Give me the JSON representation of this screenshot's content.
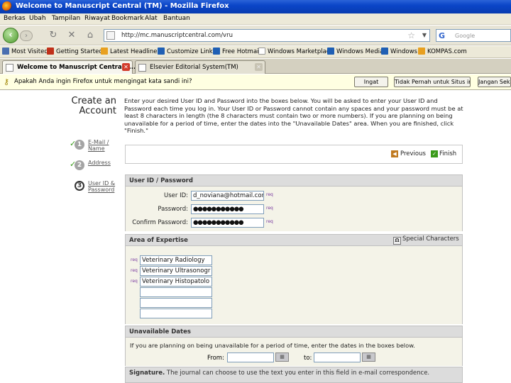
{
  "window": {
    "title": "Welcome to Manuscript Central (TM) - Mozilla Firefox"
  },
  "menu": [
    "Berkas",
    "Ubah",
    "Tampilan",
    "Riwayat",
    "Bookmark",
    "Alat",
    "Bantuan"
  ],
  "nav": {
    "url": "http://mc.manuscriptcentral.com/vru",
    "search_placeholder": "Google"
  },
  "bookmarks": [
    "Most Visited",
    "Getting Started",
    "Latest Headlines",
    "Customize Links",
    "Free Hotmail",
    "Windows Marketplace",
    "Windows Media",
    "Windows",
    "KOMPAS.com"
  ],
  "tabs": [
    {
      "label": "Welcome to Manuscript Central (..."
    },
    {
      "label": "Elsevier Editorial System(TM)"
    }
  ],
  "notification": {
    "message": "Apakah Anda ingin Firefox untuk mengingat kata sandi ini?",
    "buttons": [
      "Ingat",
      "Tidak Pernah untuk Situs ini",
      "Jangan Sekarang"
    ]
  },
  "page": {
    "title_line1": "Create an",
    "title_line2": "Account",
    "intro": "Enter your desired User ID and Password into the boxes below. You will be asked to enter your User ID and Password each time you log in. Your User ID or Password cannot contain any spaces and your password must be at least 8 characters in length (the 8 characters must contain two or more numbers). If you are planning on being unavailable for a period of time, enter the dates into the \"Unavailable Dates\" area. When you are finished, click \"Finish.\"",
    "steps": [
      {
        "num": "1",
        "label": "E-Mail / Name"
      },
      {
        "num": "2",
        "label": "Address"
      },
      {
        "num": "3",
        "label": "User ID & Password"
      }
    ],
    "previous": "Previous",
    "finish": "Finish"
  },
  "userid_section": {
    "header": "User ID / Password",
    "userid_label": "User ID:",
    "userid_value": "d_noviana@hotmail.com",
    "password_label": "Password:",
    "password_value": "●●●●●●●●●●●",
    "confirm_label": "Confirm Password:",
    "confirm_value": "●●●●●●●●●●●",
    "req": "req"
  },
  "expertise": {
    "header": "Area of Expertise",
    "special_chars": "Special Characters",
    "items": [
      "Veterinary Radiology",
      "Veterinary Ultrasonogr",
      "Veterinary Histopatolo",
      "",
      "",
      ""
    ]
  },
  "unavailable": {
    "header": "Unavailable Dates",
    "text": "If you are planning on being unavailable for a period of time, enter the dates in the boxes below.",
    "from_label": "From:",
    "to_label": "to:"
  },
  "signature": {
    "label": "Signature.",
    "text": "The journal can choose to use the text you enter in this field in e-mail correspondence."
  }
}
